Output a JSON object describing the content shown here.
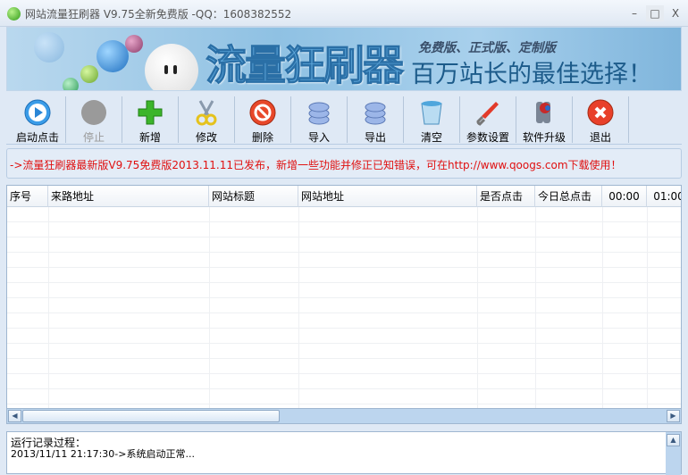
{
  "window": {
    "title": "网站流量狂刷器  V9.75全新免费版 -QQ：1608382552",
    "minimize": "–",
    "maximize": "□",
    "close": "X"
  },
  "banner": {
    "logo": "流量狂刷器",
    "tagline_small": "免费版、正式版、定制版",
    "tagline": "百万站长的最佳选择！"
  },
  "toolbar": [
    {
      "label": "启动点击",
      "icon": "play-icon"
    },
    {
      "label": "停止",
      "icon": "stop-icon",
      "disabled": true
    },
    {
      "label": "新增",
      "icon": "plus-icon"
    },
    {
      "label": "修改",
      "icon": "scissors-icon"
    },
    {
      "label": "删除",
      "icon": "delete-icon"
    },
    {
      "label": "导入",
      "icon": "database-import-icon"
    },
    {
      "label": "导出",
      "icon": "database-export-icon"
    },
    {
      "label": "清空",
      "icon": "bucket-icon"
    },
    {
      "label": "参数设置",
      "icon": "wrench-icon"
    },
    {
      "label": "软件升级",
      "icon": "keys-icon"
    },
    {
      "label": "退出",
      "icon": "exit-icon"
    }
  ],
  "notice": "->流量狂刷器最新版V9.75免费版2013.11.11已发布，新增一些功能并修正已知错误，可在http://www.qoogs.com下载使用！",
  "table": {
    "columns": [
      "序号",
      "来路地址",
      "网站标题",
      "网站地址",
      "是否点击",
      "今日总点击",
      "00:00",
      "01:00"
    ]
  },
  "log": {
    "heading": "运行记录过程：",
    "entries": [
      "2013/11/11 21:17:30->系统启动正常..."
    ]
  },
  "colors": {
    "notice": "#e01010",
    "accent": "#bcd5ee"
  }
}
